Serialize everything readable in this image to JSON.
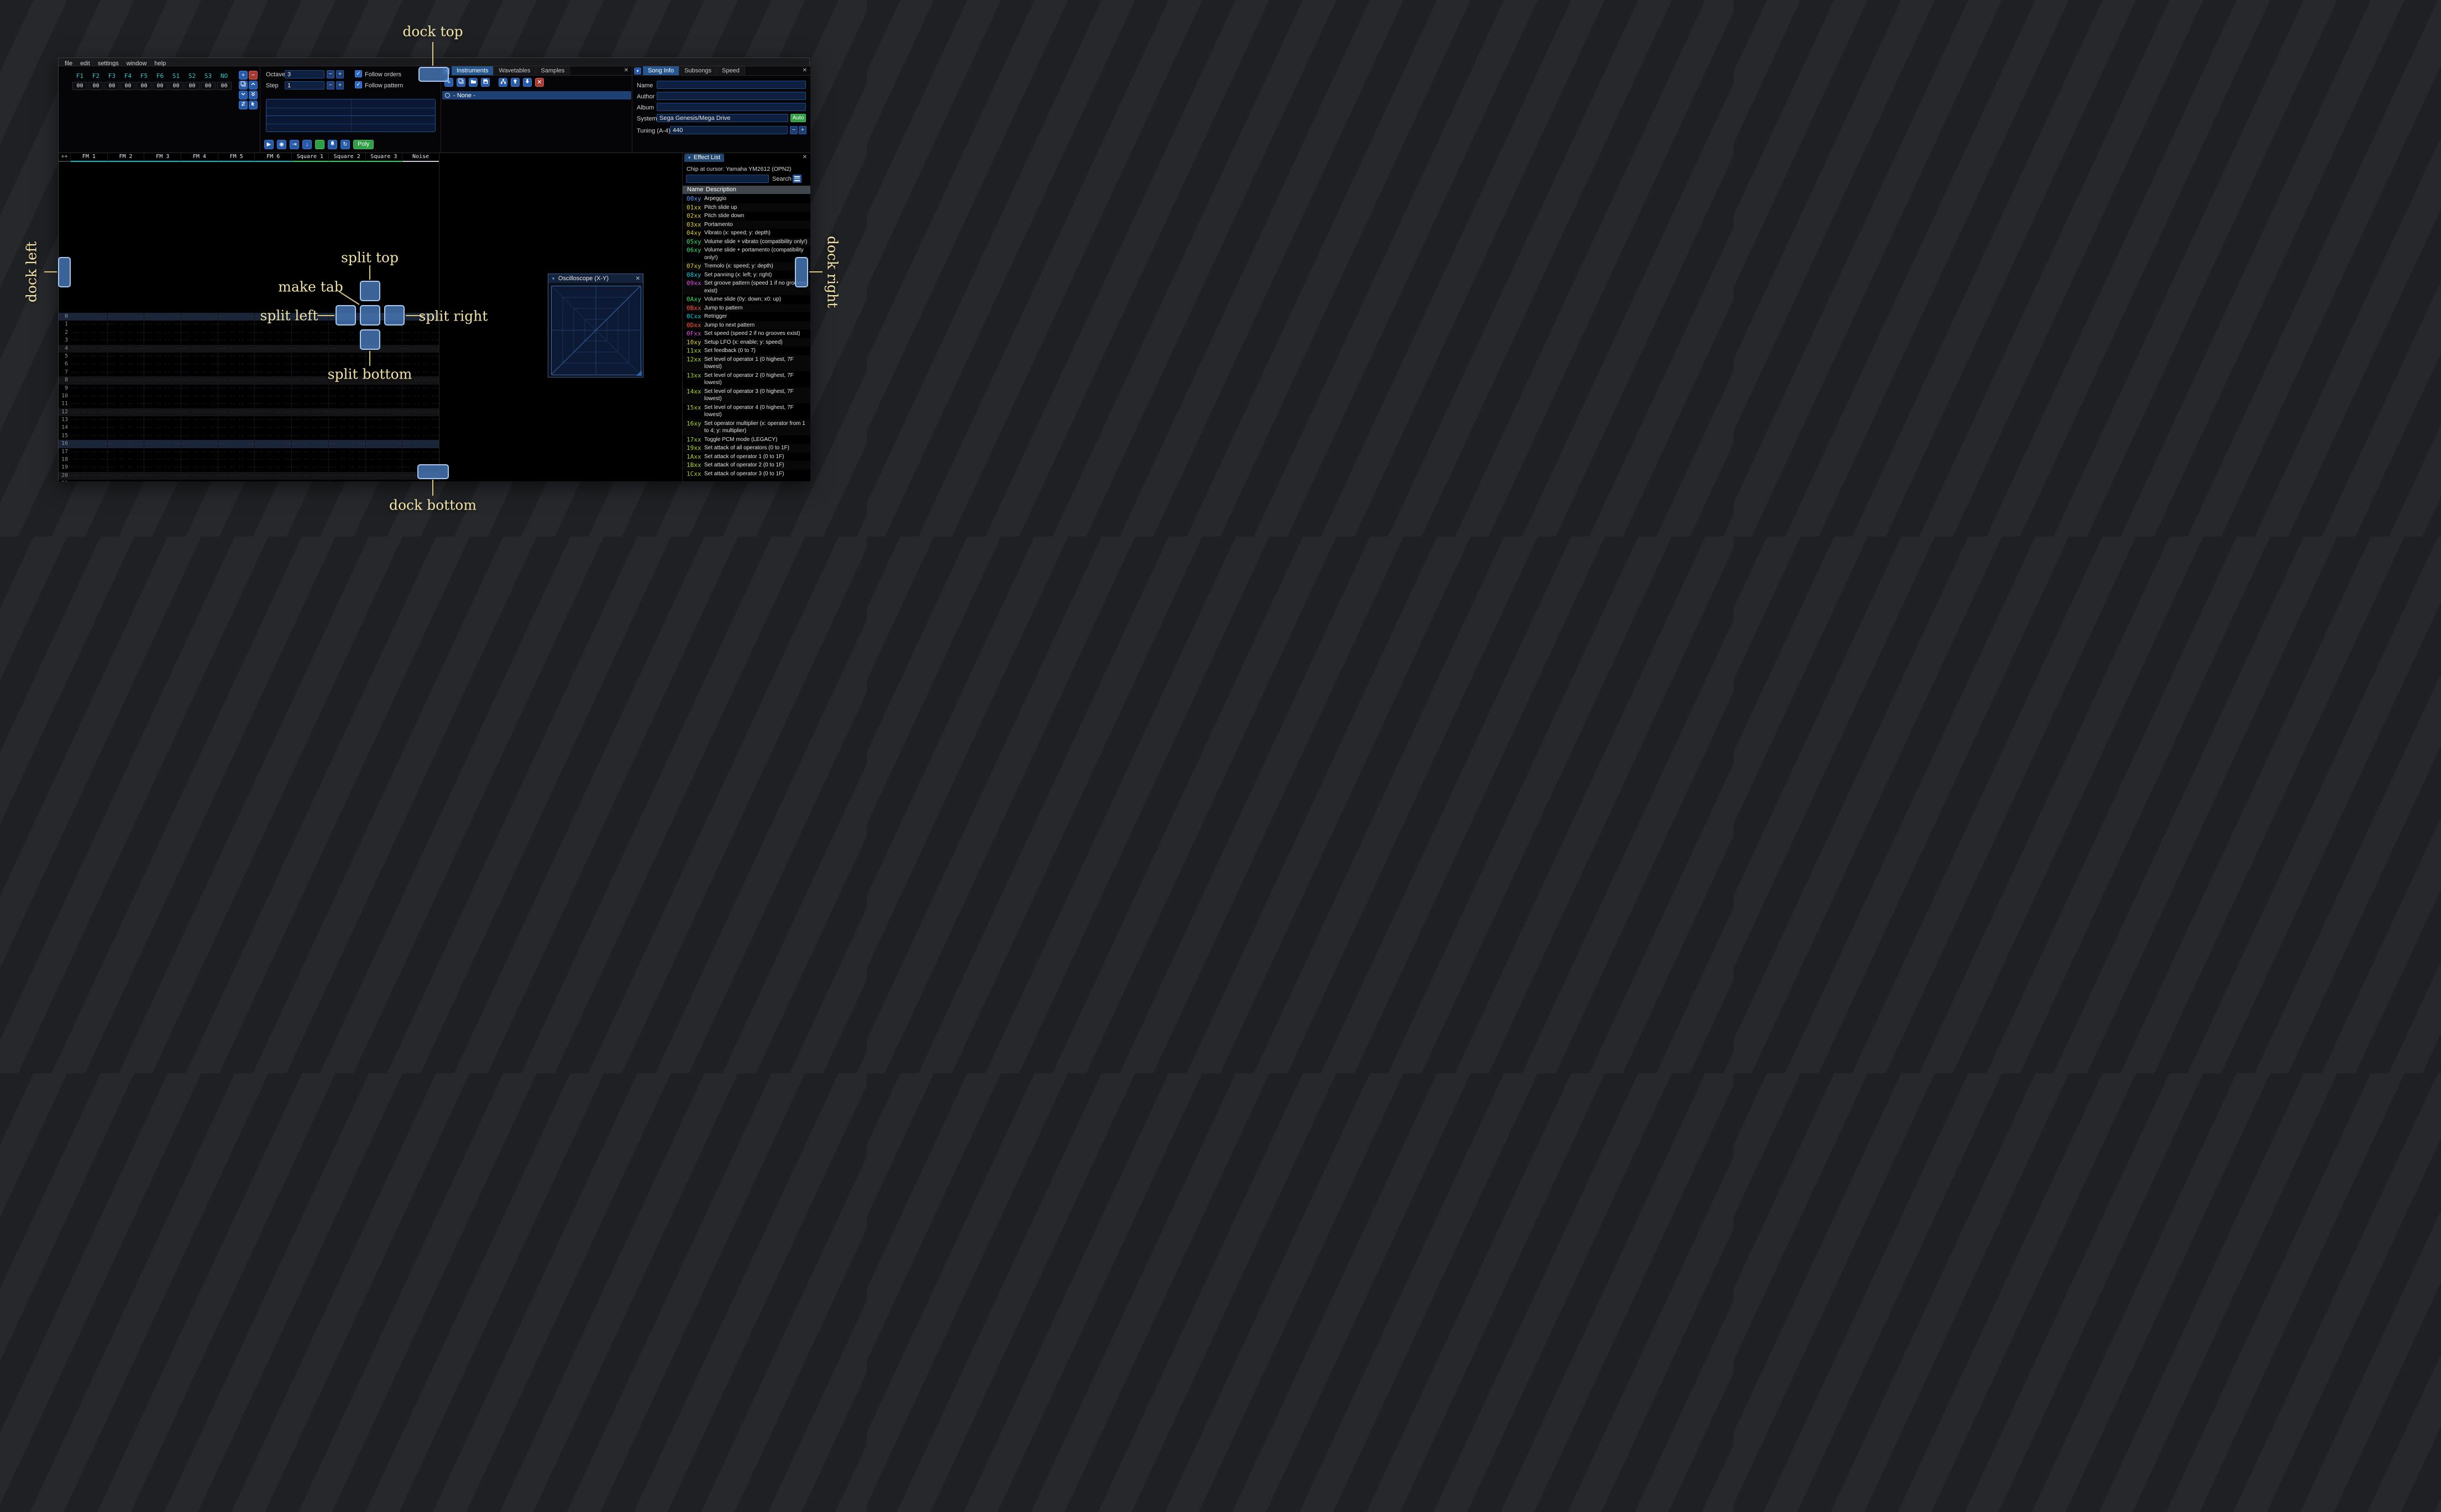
{
  "ui": {
    "close_glyph": "✕",
    "caret_glyph": "▾",
    "tri_glyph": "▼",
    "check_glyph": "✓",
    "plus_glyph": "+",
    "minus_glyph": "−"
  },
  "menu": [
    "file",
    "edit",
    "settings",
    "window",
    "help"
  ],
  "orders": {
    "channels": [
      "F1",
      "F2",
      "F3",
      "F4",
      "F5",
      "F6",
      "S1",
      "S2",
      "S3",
      "NO"
    ],
    "row": [
      "00",
      "00",
      "00",
      "00",
      "00",
      "00",
      "00",
      "00",
      "00",
      "00"
    ]
  },
  "controls": {
    "octave_label": "Octave",
    "octave_value": "3",
    "step_label": "Step",
    "step_value": "1",
    "follow_orders": "Follow orders",
    "follow_pattern": "Follow pattern",
    "poly_label": "Poly"
  },
  "transport": [
    {
      "name": "play-button",
      "glyph": "▶"
    },
    {
      "name": "play-pattern-button",
      "glyph": "◉"
    },
    {
      "name": "step-one-row-button",
      "glyph": "⇥"
    },
    {
      "name": "advance-row-button",
      "glyph": "↓"
    },
    {
      "name": "edit-toggle-button",
      "glyph": "",
      "green": true
    },
    {
      "name": "metronome-button",
      "icon": "bell"
    },
    {
      "name": "repeat-pattern-button",
      "glyph": "↻"
    }
  ],
  "instruments": {
    "tabs": [
      "Instruments",
      "Wavetables",
      "Samples"
    ],
    "active_tab": "Instruments",
    "list": [
      {
        "label": "- None -",
        "selected": true
      }
    ]
  },
  "song_info": {
    "tabs": [
      "Song Info",
      "Subsongs",
      "Speed"
    ],
    "active_tab": "Song Info",
    "name_label": "Name",
    "name_value": "",
    "author_label": "Author",
    "author_value": "",
    "album_label": "Album",
    "album_value": "",
    "system_label": "System",
    "system_value": "Sega Genesis/Mega Drive",
    "auto_label": "Auto",
    "tuning_label": "Tuning (A-4)",
    "tuning_value": "440"
  },
  "pattern": {
    "expand_label": "++",
    "channels": [
      {
        "name": "FM 1",
        "color": "#00c2cc"
      },
      {
        "name": "FM 2",
        "color": "#00c2cc"
      },
      {
        "name": "FM 3",
        "color": "#00c2cc"
      },
      {
        "name": "FM 4",
        "color": "#00c2cc"
      },
      {
        "name": "FM 5",
        "color": "#00c2cc"
      },
      {
        "name": "FM 6",
        "color": "#00c2cc"
      },
      {
        "name": "Square 1",
        "color": "#21d464"
      },
      {
        "name": "Square 2",
        "color": "#21d464"
      },
      {
        "name": "Square 3",
        "color": "#21d464"
      },
      {
        "name": "Noise",
        "color": "#c6ccd4"
      }
    ],
    "rows": 22,
    "empty_cell": "··· ·· ·· ···",
    "highlight16": [
      0,
      16
    ],
    "highlight4": [
      4,
      8,
      12,
      20
    ]
  },
  "oscilloscope": {
    "title": "Oscilloscope (X-Y)"
  },
  "effect_list": {
    "title": "Effect List",
    "chip_line": "Chip at cursor: Yamaha YM2612 (OPN2)",
    "search_label": "Search",
    "name_header": "Name",
    "desc_header": "Description",
    "effects": [
      {
        "code": "00xy",
        "color": "#4b9fff",
        "desc": "Arpeggio"
      },
      {
        "code": "01xx",
        "color": "#d8cc28",
        "desc": "Pitch slide up"
      },
      {
        "code": "02xx",
        "color": "#d8cc28",
        "desc": "Pitch slide down"
      },
      {
        "code": "03xx",
        "color": "#d8cc28",
        "desc": "Portamento"
      },
      {
        "code": "04xy",
        "color": "#d8cc28",
        "desc": "Vibrato (x: speed; y: depth)"
      },
      {
        "code": "05xy",
        "color": "#2ee065",
        "desc": "Volume slide + vibrato (compatibility only!)"
      },
      {
        "code": "06xy",
        "color": "#2ee065",
        "desc": "Volume slide + portamento (compatibility only!)"
      },
      {
        "code": "07xy",
        "color": "#d8cc28",
        "desc": "Tremolo (x: speed; y: depth)"
      },
      {
        "code": "08xy",
        "color": "#00cfe0",
        "desc": "Set panning (x: left; y: right)"
      },
      {
        "code": "09xx",
        "color": "#e04ce0",
        "desc": "Set groove pattern (speed 1 if no grooves exist)"
      },
      {
        "code": "0Axy",
        "color": "#2ee065",
        "desc": "Volume slide (0y: down; x0: up)"
      },
      {
        "code": "0Bxx",
        "color": "#ff5036",
        "desc": "Jump to pattern"
      },
      {
        "code": "0Cxx",
        "color": "#00cfe0",
        "desc": "Retrigger"
      },
      {
        "code": "0Dxx",
        "color": "#ff5036",
        "desc": "Jump to next pattern"
      },
      {
        "code": "0Fxx",
        "color": "#e04ce0",
        "desc": "Set speed (speed 2 if no grooves exist)"
      },
      {
        "code": "10xy",
        "color": "#d8cc28",
        "desc": "Setup LFO (x: enable; y: speed)"
      },
      {
        "code": "11xx",
        "color": "#a6d42a",
        "desc": "Set feedback (0 to 7)"
      },
      {
        "code": "12xx",
        "color": "#a6d42a",
        "desc": "Set level of operator 1 (0 highest, 7F lowest)"
      },
      {
        "code": "13xx",
        "color": "#a6d42a",
        "desc": "Set level of operator 2 (0 highest, 7F lowest)"
      },
      {
        "code": "14xx",
        "color": "#a6d42a",
        "desc": "Set level of operator 3 (0 highest, 7F lowest)"
      },
      {
        "code": "15xx",
        "color": "#a6d42a",
        "desc": "Set level of operator 4 (0 highest, 7F lowest)"
      },
      {
        "code": "16xy",
        "color": "#a6d42a",
        "desc": "Set operator multiplier (x: operator from 1 to 4; y: multiplier)"
      },
      {
        "code": "17xx",
        "color": "#a6d42a",
        "desc": "Toggle PCM mode (LEGACY)"
      },
      {
        "code": "19xx",
        "color": "#a6d42a",
        "desc": "Set attack of all operators (0 to 1F)"
      },
      {
        "code": "1Axx",
        "color": "#a6d42a",
        "desc": "Set attack of operator 1 (0 to 1F)"
      },
      {
        "code": "1Bxx",
        "color": "#a6d42a",
        "desc": "Set attack of operator 2 (0 to 1F)"
      },
      {
        "code": "1Cxx",
        "color": "#a6d42a",
        "desc": "Set attack of operator 3 (0 to 1F)"
      }
    ]
  },
  "overlay": {
    "dock_top": "dock top",
    "dock_bottom": "dock bottom",
    "dock_left": "dock left",
    "dock_right": "dock right",
    "split_top": "split top",
    "split_left": "split left",
    "split_right": "split right",
    "split_bottom": "split bottom",
    "make_tab": "make tab",
    "accent": "#4674b2",
    "label_color": "#f2e3a6"
  }
}
